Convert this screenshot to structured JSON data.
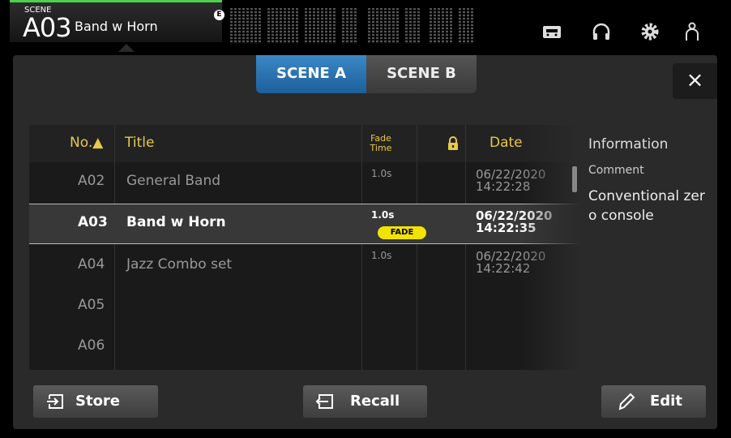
{
  "top": {
    "scene_tag": "SCENE",
    "scene_number": "A03",
    "scene_title": "Band w Horn",
    "badge": "E"
  },
  "tabs": [
    "SCENE A",
    "SCENE B"
  ],
  "close_label": "×",
  "table": {
    "headers": {
      "no": "No.▲",
      "title": "Title",
      "fade_line1": "Fade",
      "fade_line2": "Time",
      "date": "Date"
    },
    "rows": [
      {
        "no": "A02",
        "title": "General Band",
        "fade": "1.0s",
        "date": "06/22/2020",
        "time": "14:22:28",
        "selected": false,
        "fade_on": false
      },
      {
        "no": "A03",
        "title": "Band w Horn",
        "fade": "1.0s",
        "date": "06/22/2020",
        "time": "14:22:35",
        "selected": true,
        "fade_on": true
      },
      {
        "no": "A04",
        "title": "Jazz Combo set",
        "fade": "1.0s",
        "date": "06/22/2020",
        "time": "14:22:42",
        "selected": false,
        "fade_on": false
      },
      {
        "no": "A05",
        "title": "",
        "fade": "",
        "date": "",
        "time": "",
        "selected": false,
        "fade_on": false
      },
      {
        "no": "A06",
        "title": "",
        "fade": "",
        "date": "",
        "time": "",
        "selected": false,
        "fade_on": false
      }
    ],
    "fade_badge": "FADE"
  },
  "info": {
    "heading": "Information",
    "comment_label": "Comment",
    "comment_text": "Conventional zero console"
  },
  "buttons": {
    "store": "Store",
    "recall": "Recall",
    "edit": "Edit"
  },
  "colors": {
    "accent_blue": "#2a78b8",
    "header_yellow": "#e6c84a",
    "fade_badge": "#f2e200",
    "scene_green": "#4ed04e"
  }
}
